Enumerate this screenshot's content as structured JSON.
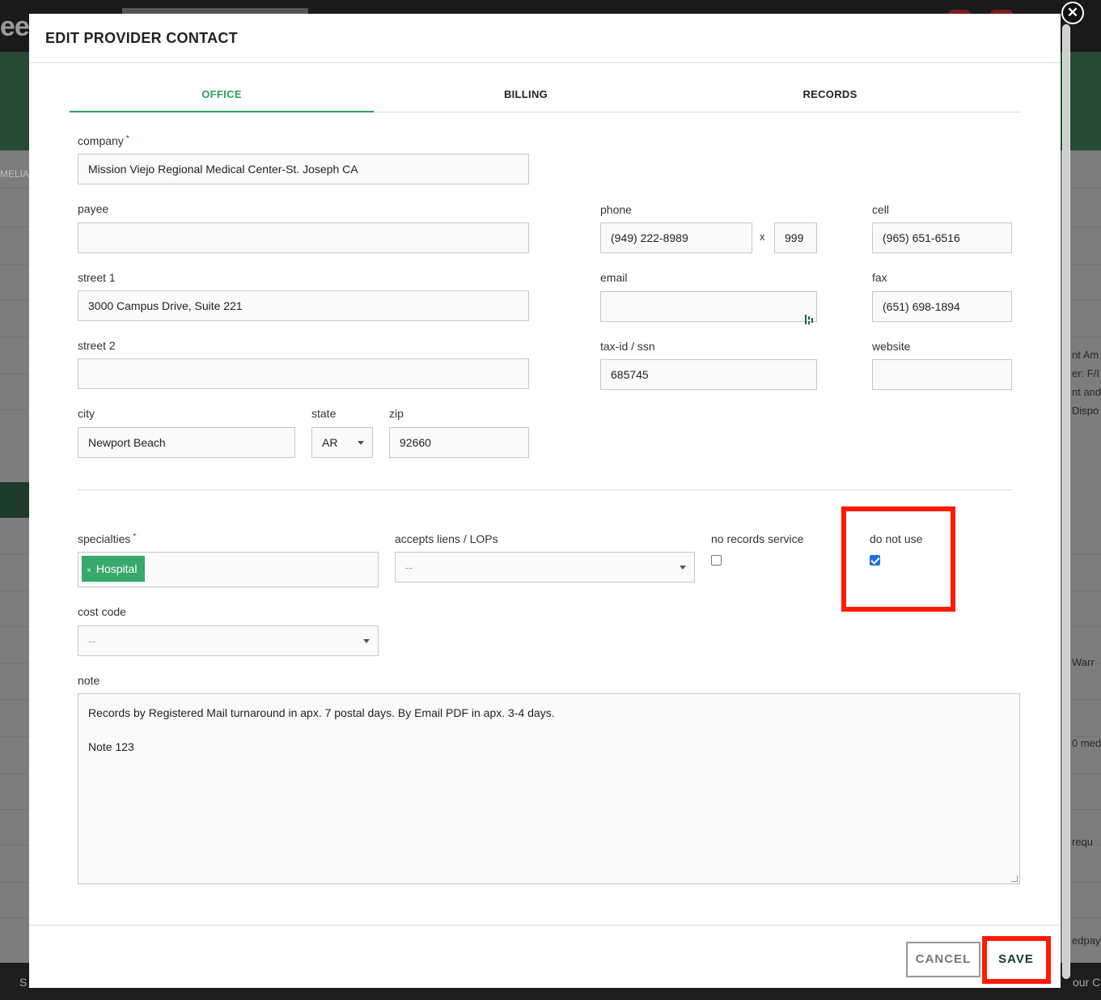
{
  "modal": {
    "title": "EDIT PROVIDER CONTACT",
    "close_glyph": "✕"
  },
  "tabs": [
    {
      "label": "OFFICE",
      "active": true
    },
    {
      "label": "BILLING",
      "active": false
    },
    {
      "label": "RECORDS",
      "active": false
    }
  ],
  "form": {
    "company": {
      "label": "company",
      "required_mark": "*",
      "value": "Mission Viejo Regional Medical Center-St. Joseph CA"
    },
    "payee": {
      "label": "payee",
      "value": ""
    },
    "street1": {
      "label": "street 1",
      "value": "3000 Campus Drive, Suite 221"
    },
    "street2": {
      "label": "street 2",
      "value": ""
    },
    "city": {
      "label": "city",
      "value": "Newport Beach"
    },
    "state": {
      "label": "state",
      "value": "AR"
    },
    "zip": {
      "label": "zip",
      "value": "92660"
    },
    "phone": {
      "label": "phone",
      "value": "(949) 222-8989",
      "ext_separator": "x",
      "ext_value": "999"
    },
    "email": {
      "label": "email",
      "value": ""
    },
    "tax_id": {
      "label": "tax-id / ssn",
      "value": "685745"
    },
    "cell": {
      "label": "cell",
      "value": "(965) 651-6516"
    },
    "fax": {
      "label": "fax",
      "value": "(651) 698-1894"
    },
    "website": {
      "label": "website",
      "value": ""
    },
    "specialties": {
      "label": "specialties",
      "required_mark": "*",
      "tags": [
        {
          "label": "Hospital",
          "remove_glyph": "×"
        }
      ]
    },
    "accepts_liens": {
      "label": "accepts liens / LOPs",
      "value": "--"
    },
    "no_records_service": {
      "label": "no records service",
      "checked": false
    },
    "do_not_use": {
      "label": "do not use",
      "checked": true
    },
    "cost_code": {
      "label": "cost code",
      "value": "--"
    },
    "note": {
      "label": "note",
      "lines": [
        "Records by Registered Mail turnaround in apx. 7 postal days. By Email PDF in apx. 3-4 days.",
        "",
        "Note 123"
      ]
    }
  },
  "footer": {
    "cancel_label": "CANCEL",
    "save_label": "SAVE"
  },
  "background": {
    "logo_fragment": "ee",
    "left_label": "MELIA",
    "right_fragments": [
      "nt Am",
      "er: F/I",
      "nt and",
      "Dispo",
      "Warr",
      "0 med",
      "requ",
      "edpay"
    ],
    "bottom_left": "S",
    "bottom_right": "our C"
  },
  "colors": {
    "accent_green": "#2e9e5e",
    "tag_green": "#37a96a",
    "highlight_red": "#ff1a00",
    "save_text": "#0f3d2a"
  }
}
